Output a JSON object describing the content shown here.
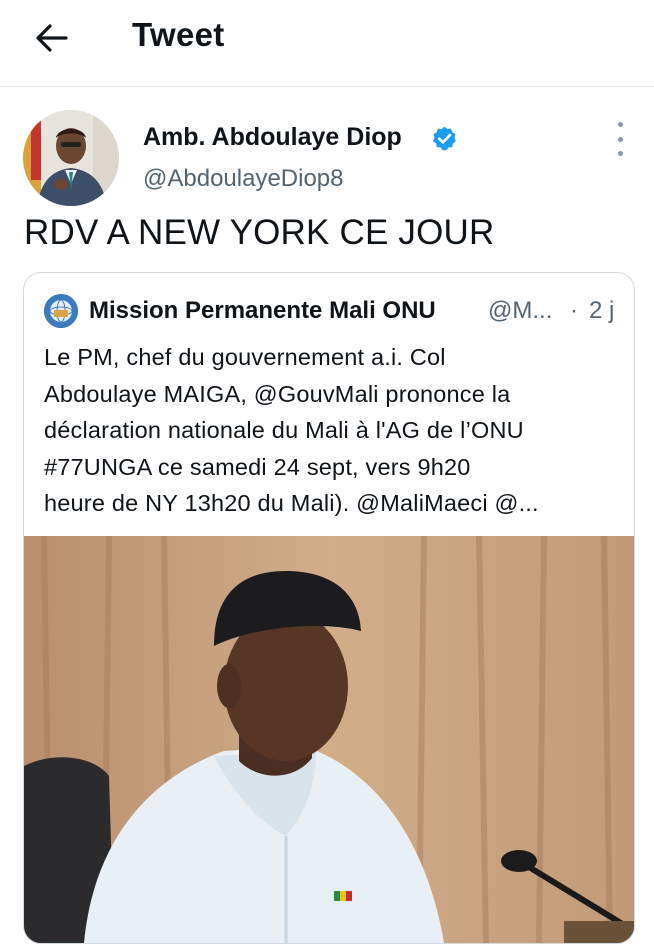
{
  "header": {
    "title": "Tweet",
    "back_icon": "arrow-left-icon"
  },
  "tweet": {
    "author_name": "Amb. Abdoulaye Diop",
    "author_handle": "@AbdoulayeDiop8",
    "verified": true,
    "text": "RDV A NEW YORK CE JOUR"
  },
  "quoted_tweet": {
    "author_name": "Mission Permanente Mali ONU",
    "author_handle": "@M...",
    "separator": "·",
    "time": "2 j",
    "lines": [
      "Le PM, chef du gouvernement a.i. Col",
      "Abdoulaye MAIGA, @GouvMali prononce la",
      "déclaration nationale du Mali à l'AG de l’ONU",
      "#77UNGA ce samedi 24 sept, vers 9h20",
      "heure de NY 13h20 du Mali). @MaliMaeci @..."
    ]
  },
  "colors": {
    "verified_blue": "#1d9bf0",
    "secondary_text": "#536471",
    "border": "#cfd9de",
    "divider": "#e6ecf0"
  }
}
